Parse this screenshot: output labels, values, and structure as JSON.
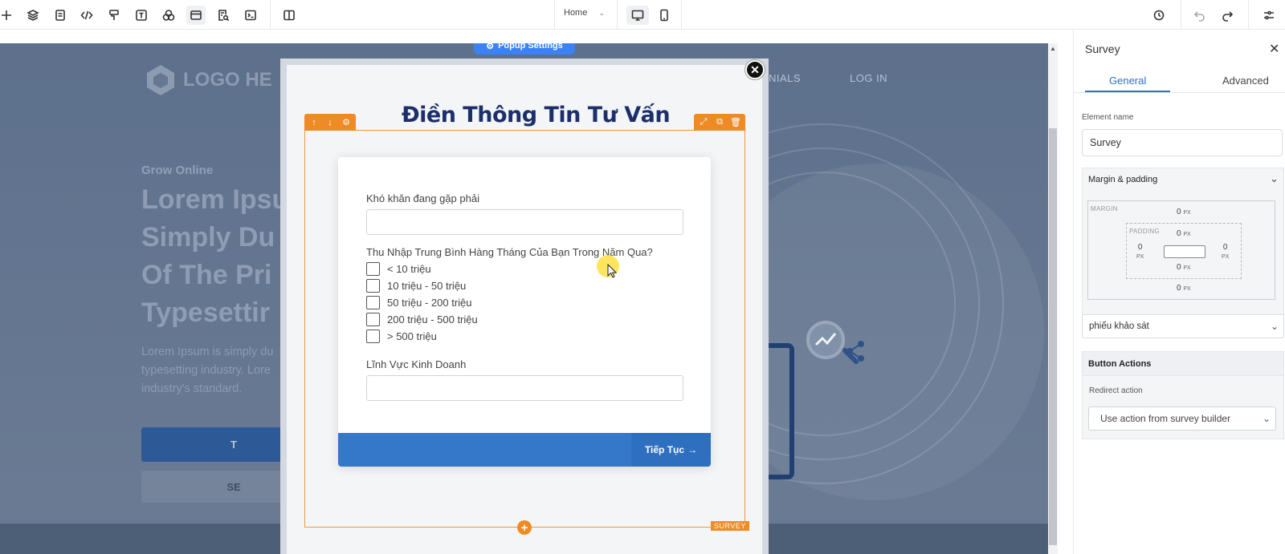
{
  "toolbar": {
    "page_select": "Home",
    "left_icons": [
      "add-icon",
      "layers-icon",
      "page-icon",
      "code-icon",
      "paint-icon",
      "text-icon",
      "shapes-icon",
      "section-icon",
      "search-doc-icon",
      "terminal-icon",
      "split-view-icon"
    ],
    "view_modes": [
      "desktop-icon",
      "mobile-icon"
    ],
    "right_icons": [
      "history-icon",
      "undo-icon",
      "redo-icon",
      "settings-sliders-icon"
    ]
  },
  "canvas": {
    "popup_settings": "Popup Settings",
    "site": {
      "logo_text": "LOGO HE",
      "nav": [
        "NIALS",
        "LOG IN"
      ],
      "eyebrow": "Grow Online",
      "hero_lines": [
        "Lorem Ipsu",
        "Simply Du",
        "Of The Pri",
        "Typesettir"
      ],
      "desc_lines": [
        "Lorem Ipsum is simply du",
        "typesetting industry. Lore",
        "industry's standard."
      ],
      "primary_button": "T",
      "secondary_button": "SE"
    }
  },
  "popup": {
    "title": "Điền Thông Tin Tư Vấn",
    "element_tag": "SURVEY",
    "questions": {
      "q1": "Khó khăn đang gặp phải",
      "q2": "Thu Nhập Trung Bình Hàng Tháng Của Bạn Trong Năm Qua?",
      "q2_options": [
        "< 10 triệu",
        "10 triệu - 50 triệu",
        "50 triệu - 200 triệu",
        "200 triệu - 500 triệu",
        "> 500 triệu"
      ],
      "q3": "Lĩnh Vực Kinh Doanh"
    },
    "next_button": "Tiếp Tục"
  },
  "panel": {
    "title": "Survey",
    "tabs": [
      "General",
      "Advanced"
    ],
    "element_name_label": "Element name",
    "element_name_value": "Survey",
    "margin_padding": {
      "title": "Margin & padding",
      "margin_label": "MARGIN",
      "padding_label": "PADDING",
      "margin_top": "0",
      "margin_bottom": "0",
      "padding_top": "0",
      "padding_bottom": "0",
      "padding_left": "0",
      "padding_right": "0",
      "unit": "PX"
    },
    "survey_select": "phiếu khảo sát",
    "button_actions": {
      "title": "Button Actions",
      "redirect_label": "Redirect action",
      "redirect_value": "Use action from survey builder"
    }
  },
  "colors": {
    "accent_blue": "#2f6fc0",
    "frame_orange": "#f08a24",
    "title_navy": "#1c2f6b"
  }
}
